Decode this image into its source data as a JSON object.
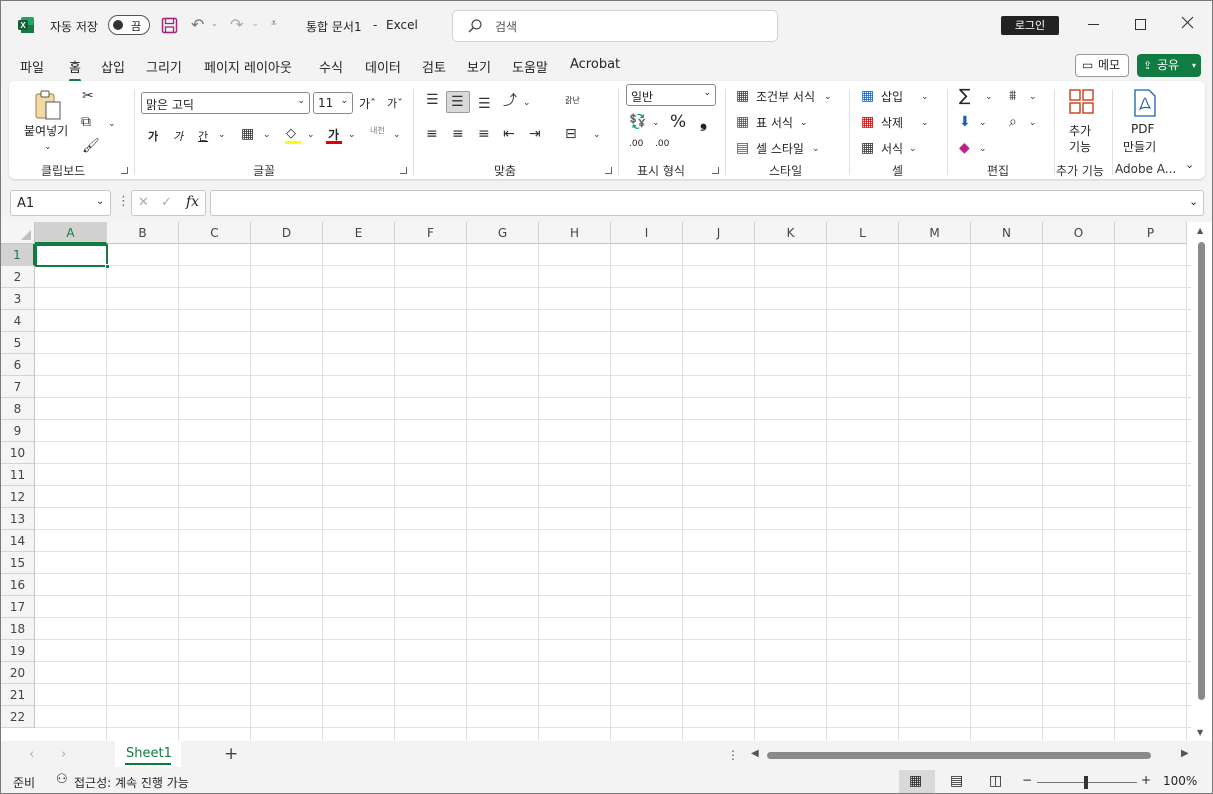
{
  "titlebar": {
    "autosave_label": "자동 저장",
    "autosave_state": "끔",
    "doc_title": "통합 문서1",
    "separator": "-",
    "app_name": "Excel",
    "search_placeholder": "검색",
    "login_label": "로그인"
  },
  "menu": {
    "tabs": [
      "파일",
      "홈",
      "삽입",
      "그리기",
      "페이지 레이아웃",
      "수식",
      "데이터",
      "검토",
      "보기",
      "도움말",
      "Acrobat"
    ],
    "memo_label": "메모",
    "share_label": "공유"
  },
  "ribbon": {
    "clipboard": {
      "paste_label": "붙여넣기",
      "group_label": "클립보드"
    },
    "font": {
      "font_name": "맑은 고딕",
      "font_size": "11",
      "grow": "가ˆ",
      "shrink": "가ˇ",
      "bold": "가",
      "italic": "가",
      "underline": "간",
      "fill_glyph": "◇",
      "color_glyph": "가",
      "phonetic": "내천",
      "group_label": "글꼴"
    },
    "alignment": {
      "wrap_glyph": "갉난",
      "group_label": "맞춤"
    },
    "number": {
      "format": "일반",
      "percent": "%",
      "comma": "❟",
      "dec_inc": ".00",
      "dec_dec": ".00",
      "group_label": "표시 형식"
    },
    "styles": {
      "conditional": "조건부 서식",
      "table": "표 서식",
      "cell_styles": "셀 스타일",
      "group_label": "스타일"
    },
    "cells": {
      "insert": "삽입",
      "delete": "삭제",
      "format": "서식",
      "group_label": "셀"
    },
    "editing": {
      "sum_glyph": "∑",
      "group_label": "편집"
    },
    "addins": {
      "label_line1": "추가",
      "label_line2": "기능",
      "group_label": "추가 기능"
    },
    "adobe": {
      "label_line1": "PDF",
      "label_line2": "만들기",
      "group_label": "Adobe A..."
    }
  },
  "formula_bar": {
    "name_box": "A1",
    "fx": "fx",
    "value": ""
  },
  "grid": {
    "columns": [
      "A",
      "B",
      "C",
      "D",
      "E",
      "F",
      "G",
      "H",
      "I",
      "J",
      "K",
      "L",
      "M",
      "N",
      "O",
      "P"
    ],
    "rows": [
      "1",
      "2",
      "3",
      "4",
      "5",
      "6",
      "7",
      "8",
      "9",
      "10",
      "11",
      "12",
      "13",
      "14",
      "15",
      "16",
      "17",
      "18",
      "19",
      "20",
      "21",
      "22"
    ],
    "selected_cell": "A1"
  },
  "sheets": {
    "tabs": [
      "Sheet1"
    ],
    "add_glyph": "+"
  },
  "status": {
    "ready": "준비",
    "accessibility": "접근성: 계속 진행 가능",
    "zoom_minus": "−",
    "zoom_plus": "+",
    "zoom": "100%"
  },
  "colors": {
    "accent": "#107c41",
    "excel_green": "#1d6f42"
  }
}
